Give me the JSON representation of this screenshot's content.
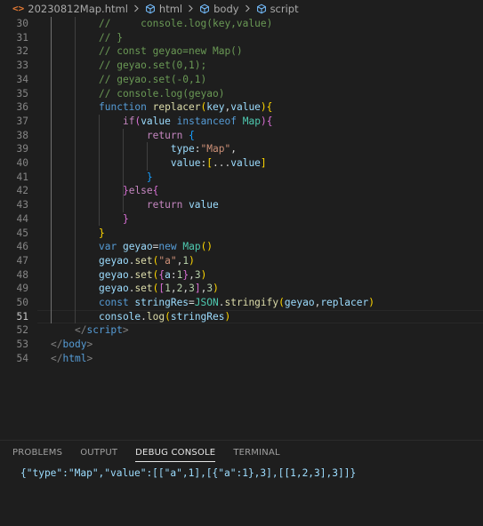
{
  "breadcrumb": {
    "file_icon": "html-file-icon",
    "file": "20230812Map.html",
    "items": [
      "html",
      "body",
      "script"
    ],
    "item_icon": "symbol-structure-icon",
    "separator_icon": "chevron-right-icon"
  },
  "editor": {
    "active_line": 51,
    "lines": [
      {
        "n": 30,
        "tokens": [
          [
            "com",
            "//     console.log(key,value)"
          ]
        ]
      },
      {
        "n": 31,
        "tokens": [
          [
            "com",
            "// }"
          ]
        ]
      },
      {
        "n": 32,
        "tokens": [
          [
            "com",
            "// const geyao=new Map()"
          ]
        ]
      },
      {
        "n": 33,
        "tokens": [
          [
            "com",
            "// geyao.set(0,1);"
          ]
        ]
      },
      {
        "n": 34,
        "tokens": [
          [
            "com",
            "// geyao.set(-0,1)"
          ]
        ]
      },
      {
        "n": 35,
        "tokens": [
          [
            "com",
            "// console.log(geyao)"
          ]
        ]
      },
      {
        "n": 36,
        "tokens": [
          [
            "kw",
            "function "
          ],
          [
            "fn",
            "replacer"
          ],
          [
            "br1",
            "("
          ],
          [
            "var",
            "key"
          ],
          [
            "pun",
            ","
          ],
          [
            "var",
            "value"
          ],
          [
            "br1",
            ")"
          ],
          [
            "br1",
            "{"
          ]
        ]
      },
      {
        "n": 37,
        "tokens": [
          [
            "pun",
            "    "
          ],
          [
            "ctl",
            "if"
          ],
          [
            "br2",
            "("
          ],
          [
            "var",
            "value"
          ],
          [
            "pun",
            " "
          ],
          [
            "kw",
            "instanceof"
          ],
          [
            "pun",
            " "
          ],
          [
            "cls",
            "Map"
          ],
          [
            "br2",
            ")"
          ],
          [
            "br2",
            "{"
          ]
        ]
      },
      {
        "n": 38,
        "tokens": [
          [
            "pun",
            "        "
          ],
          [
            "ctl",
            "return"
          ],
          [
            "pun",
            " "
          ],
          [
            "br3",
            "{"
          ]
        ]
      },
      {
        "n": 39,
        "tokens": [
          [
            "pun",
            "            "
          ],
          [
            "var",
            "type"
          ],
          [
            "pun",
            ":"
          ],
          [
            "str",
            "\"Map\""
          ],
          [
            "pun",
            ","
          ]
        ]
      },
      {
        "n": 40,
        "tokens": [
          [
            "pun",
            "            "
          ],
          [
            "var",
            "value"
          ],
          [
            "pun",
            ":"
          ],
          [
            "br1",
            "["
          ],
          [
            "pun",
            "..."
          ],
          [
            "var",
            "value"
          ],
          [
            "br1",
            "]"
          ]
        ]
      },
      {
        "n": 41,
        "tokens": [
          [
            "pun",
            "        "
          ],
          [
            "br3",
            "}"
          ]
        ]
      },
      {
        "n": 42,
        "tokens": [
          [
            "pun",
            "    "
          ],
          [
            "br2",
            "}"
          ],
          [
            "ctl",
            "else"
          ],
          [
            "br2",
            "{"
          ]
        ]
      },
      {
        "n": 43,
        "tokens": [
          [
            "pun",
            "        "
          ],
          [
            "ctl",
            "return"
          ],
          [
            "pun",
            " "
          ],
          [
            "var",
            "value"
          ]
        ]
      },
      {
        "n": 44,
        "tokens": [
          [
            "pun",
            "    "
          ],
          [
            "br2",
            "}"
          ]
        ]
      },
      {
        "n": 45,
        "tokens": [
          [
            "br1",
            "}"
          ]
        ]
      },
      {
        "n": 46,
        "tokens": [
          [
            "kw",
            "var "
          ],
          [
            "var",
            "geyao"
          ],
          [
            "pun",
            "="
          ],
          [
            "kw",
            "new "
          ],
          [
            "cls",
            "Map"
          ],
          [
            "br1",
            "()"
          ]
        ]
      },
      {
        "n": 47,
        "tokens": [
          [
            "var",
            "geyao"
          ],
          [
            "pun",
            "."
          ],
          [
            "fn",
            "set"
          ],
          [
            "br1",
            "("
          ],
          [
            "str",
            "\"a\""
          ],
          [
            "pun",
            ","
          ],
          [
            "num",
            "1"
          ],
          [
            "br1",
            ")"
          ]
        ]
      },
      {
        "n": 48,
        "tokens": [
          [
            "var",
            "geyao"
          ],
          [
            "pun",
            "."
          ],
          [
            "fn",
            "set"
          ],
          [
            "br1",
            "("
          ],
          [
            "br2",
            "{"
          ],
          [
            "var",
            "a"
          ],
          [
            "pun",
            ":"
          ],
          [
            "num",
            "1"
          ],
          [
            "br2",
            "}"
          ],
          [
            "pun",
            ","
          ],
          [
            "num",
            "3"
          ],
          [
            "br1",
            ")"
          ]
        ]
      },
      {
        "n": 49,
        "tokens": [
          [
            "var",
            "geyao"
          ],
          [
            "pun",
            "."
          ],
          [
            "fn",
            "set"
          ],
          [
            "br1",
            "("
          ],
          [
            "br2",
            "["
          ],
          [
            "num",
            "1"
          ],
          [
            "pun",
            ","
          ],
          [
            "num",
            "2"
          ],
          [
            "pun",
            ","
          ],
          [
            "num",
            "3"
          ],
          [
            "br2",
            "]"
          ],
          [
            "pun",
            ","
          ],
          [
            "num",
            "3"
          ],
          [
            "br1",
            ")"
          ]
        ]
      },
      {
        "n": 50,
        "tokens": [
          [
            "kw",
            "const "
          ],
          [
            "var",
            "stringRes"
          ],
          [
            "pun",
            "="
          ],
          [
            "cls",
            "JSON"
          ],
          [
            "pun",
            "."
          ],
          [
            "fn",
            "stringify"
          ],
          [
            "br1",
            "("
          ],
          [
            "var",
            "geyao"
          ],
          [
            "pun",
            ","
          ],
          [
            "var",
            "replacer"
          ],
          [
            "br1",
            ")"
          ]
        ]
      },
      {
        "n": 51,
        "tokens": [
          [
            "var",
            "console"
          ],
          [
            "pun",
            "."
          ],
          [
            "fn",
            "log"
          ],
          [
            "br1",
            "("
          ],
          [
            "var",
            "stringRes"
          ],
          [
            "br1",
            ")"
          ]
        ]
      },
      {
        "n": 52,
        "tokens": [
          [
            "tag",
            "</"
          ],
          [
            "tname",
            "script"
          ],
          [
            "tag",
            ">"
          ]
        ]
      },
      {
        "n": 53,
        "tokens": [
          [
            "tag",
            "</"
          ],
          [
            "tname",
            "body"
          ],
          [
            "tag",
            ">"
          ]
        ]
      },
      {
        "n": 54,
        "tokens": [
          [
            "tag",
            "</"
          ],
          [
            "tname",
            "html"
          ],
          [
            "tag",
            ">"
          ]
        ]
      }
    ]
  },
  "panel": {
    "tabs": [
      "PROBLEMS",
      "OUTPUT",
      "DEBUG CONSOLE",
      "TERMINAL"
    ],
    "active_tab": "DEBUG CONSOLE",
    "output": "{\"type\":\"Map\",\"value\":[[\"a\",1],[{\"a\":1},3],[[1,2,3],3]]}"
  }
}
